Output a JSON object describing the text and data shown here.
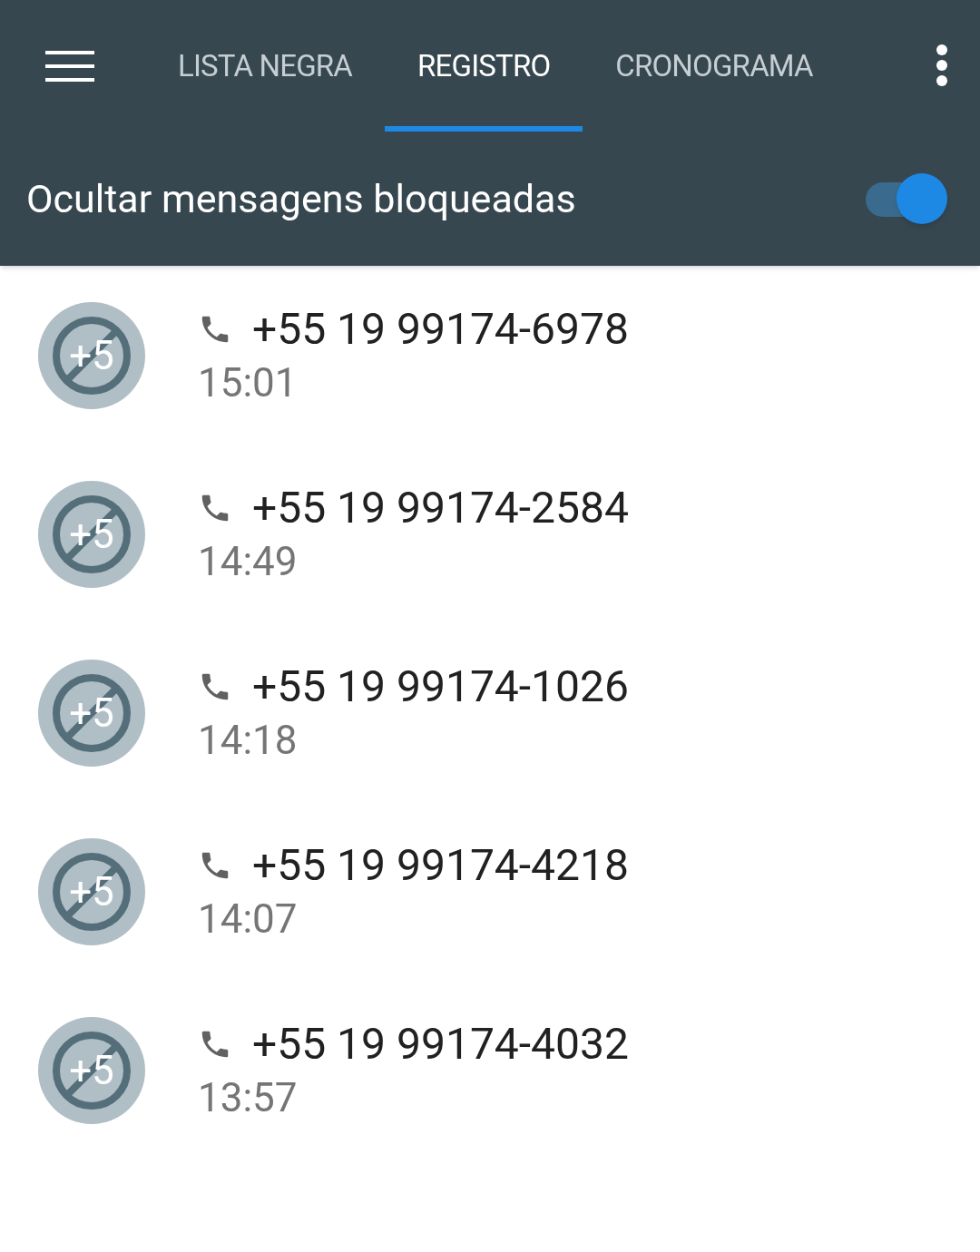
{
  "tabs": [
    {
      "label": "LISTA NEGRA",
      "selected": false
    },
    {
      "label": "REGISTRO",
      "selected": true
    },
    {
      "label": "CRONOGRAMA",
      "selected": false
    }
  ],
  "setting": {
    "label": "Ocultar mensagens bloqueadas",
    "on": true
  },
  "entries": [
    {
      "avatar": "+5",
      "number": "+55 19 99174-6978",
      "time": "15:01"
    },
    {
      "avatar": "+5",
      "number": "+55 19 99174-2584",
      "time": "14:49"
    },
    {
      "avatar": "+5",
      "number": "+55 19 99174-1026",
      "time": "14:18"
    },
    {
      "avatar": "+5",
      "number": "+55 19 99174-4218",
      "time": "14:07"
    },
    {
      "avatar": "+5",
      "number": "+55 19 99174-4032",
      "time": "13:57"
    }
  ]
}
